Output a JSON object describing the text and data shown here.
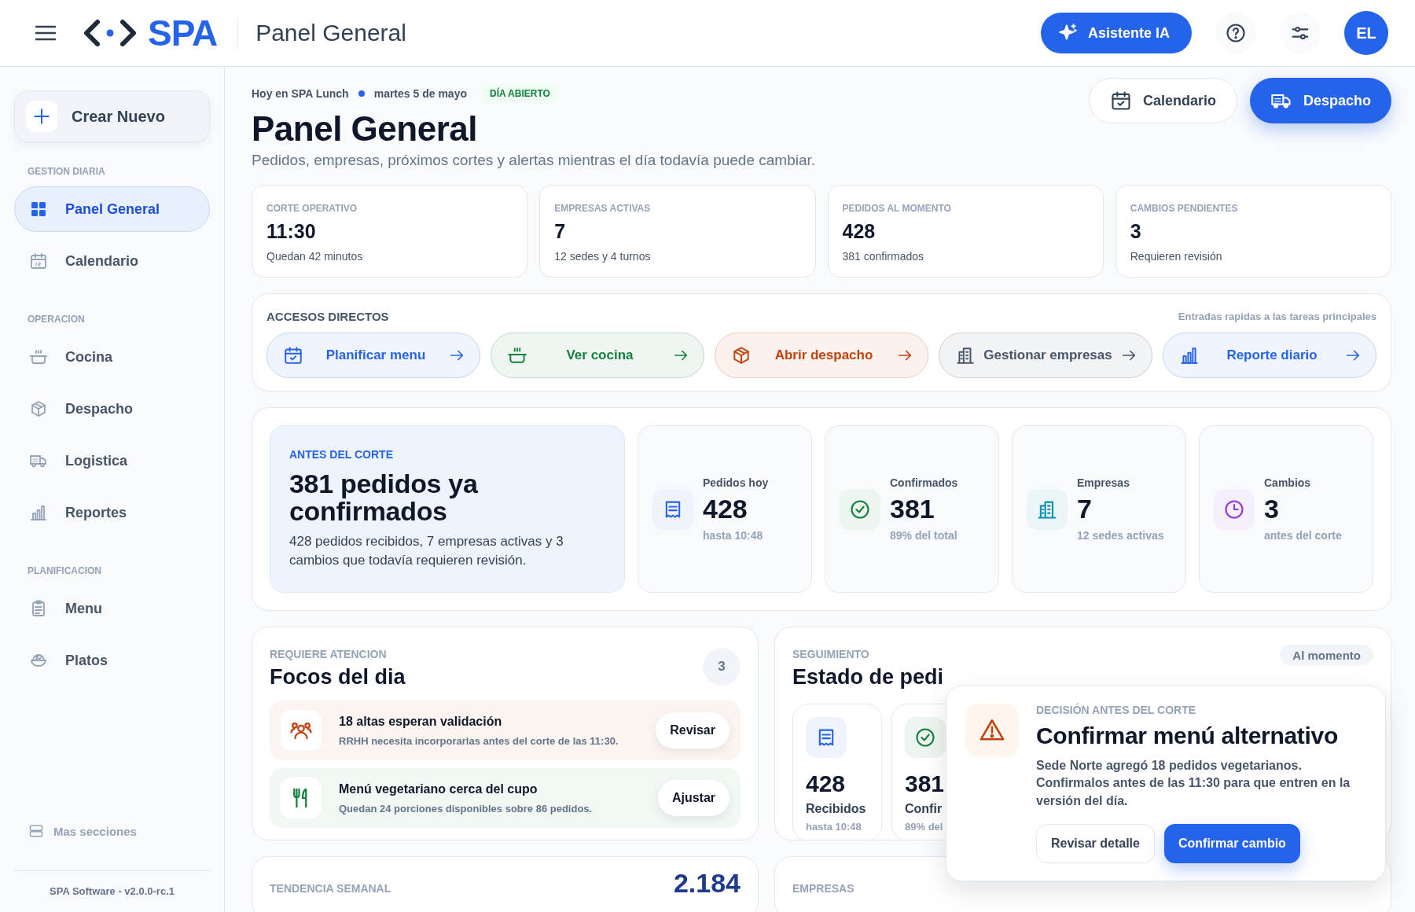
{
  "topbar": {
    "title": "Panel General",
    "logo_text": "SPA",
    "assistant_button": "Asistente IA",
    "avatar_initials": "EL"
  },
  "sidebar": {
    "create_button": "Crear Nuevo",
    "sections": [
      {
        "heading": "GESTION DIARIA",
        "items": [
          {
            "label": "Panel General",
            "selected": true
          },
          {
            "label": "Calendario",
            "selected": false
          }
        ]
      },
      {
        "heading": "OPERACION",
        "items": [
          {
            "label": "Cocina",
            "selected": false
          },
          {
            "label": "Despacho",
            "selected": false
          },
          {
            "label": "Logistica",
            "selected": false
          },
          {
            "label": "Reportes",
            "selected": false
          }
        ]
      },
      {
        "heading": "PLANIFICACION",
        "items": [
          {
            "label": "Menu",
            "selected": false
          },
          {
            "label": "Platos",
            "selected": false
          }
        ]
      }
    ],
    "more_link": "Mas secciones",
    "footer": "SPA Software - v2.0.0-rc.1"
  },
  "header": {
    "context": "Hoy en SPA Lunch",
    "date": "martes 5 de mayo",
    "day_status": "DÍA ABIERTO",
    "title": "Panel General",
    "subtitle": "Pedidos, empresas, próximos cortes y alertas mientras el día todavía puede cambiar.",
    "actions": [
      {
        "label": "Calendario",
        "kind": "secondary"
      },
      {
        "label": "Despacho",
        "kind": "primary"
      }
    ]
  },
  "stat_cards": [
    {
      "label": "CORTE OPERATIVO",
      "value": "11:30",
      "note": "Quedan 42 minutos"
    },
    {
      "label": "EMPRESAS ACTIVAS",
      "value": "7",
      "note": "12 sedes y 4 turnos"
    },
    {
      "label": "PEDIDOS AL MOMENTO",
      "value": "428",
      "note": "381 confirmados"
    },
    {
      "label": "CAMBIOS PENDIENTES",
      "value": "3",
      "note": "Requieren revisión"
    }
  ],
  "shortcuts": {
    "heading": "ACCESOS DIRECTOS",
    "hint": "Entradas rapidas a las tareas principales",
    "items": [
      {
        "label": "Planificar menu",
        "color": "#2563eb"
      },
      {
        "label": "Ver cocina",
        "color": "#15803d"
      },
      {
        "label": "Abrir despacho",
        "color": "#c2410c"
      },
      {
        "label": "Gestionar empresas",
        "color": "#475569"
      },
      {
        "label": "Reporte diario",
        "color": "#2563eb"
      }
    ]
  },
  "overview": {
    "hero": {
      "eyebrow": "ANTES DEL CORTE",
      "title": "381 pedidos ya confirmados",
      "text": "428 pedidos recibidos, 7 empresas activas y 3 cambios que todavía requieren revisión."
    },
    "metrics": [
      {
        "label": "Pedidos hoy",
        "value": "428",
        "note": "hasta 10:48",
        "color": "#2563eb"
      },
      {
        "label": "Confirmados",
        "value": "381",
        "note": "89% del total",
        "color": "#15803d"
      },
      {
        "label": "Empresas",
        "value": "7",
        "note": "12 sedes activas",
        "color": "#0891b2"
      },
      {
        "label": "Cambios",
        "value": "3",
        "note": "antes del corte",
        "color": "#9333ea"
      }
    ]
  },
  "focus": {
    "eyebrow": "REQUIERE ATENCION",
    "title": "Focos del dia",
    "count": "3",
    "items": [
      {
        "title": "18 altas esperan validación",
        "text": "RRHH necesita incorporarlas antes del corte de las 11:30.",
        "action": "Revisar",
        "color": "#c2410c"
      },
      {
        "title": "Menú vegetariano cerca del cupo",
        "text": "Quedan 24 porciones disponibles sobre 86 pedidos.",
        "action": "Ajustar",
        "color": "#15803d"
      }
    ]
  },
  "tracking": {
    "eyebrow": "SEGUIMIENTO",
    "title": "Estado de pedi",
    "badge": "Al momento",
    "tiles": [
      {
        "value": "428",
        "label": "Recibidos",
        "note": "hasta 10:48",
        "color": "#2563eb"
      },
      {
        "value": "381",
        "label": "Confir",
        "note": "89% del",
        "color": "#15803d"
      }
    ]
  },
  "trend": {
    "eyebrow": "TENDENCIA SEMANAL",
    "value": "2.184"
  },
  "companies": {
    "eyebrow": "EMPRESAS"
  },
  "decision_popup": {
    "eyebrow": "DECISIÓN ANTES DEL CORTE",
    "title": "Confirmar menú alternativo",
    "text": "Sede Norte agregó 18 pedidos vegetarianos. Confirmalos antes de las 11:30 para que entren en la versión del día.",
    "buttons": [
      {
        "label": "Revisar detalle",
        "kind": "secondary"
      },
      {
        "label": "Confirmar cambio",
        "kind": "primary"
      }
    ]
  }
}
